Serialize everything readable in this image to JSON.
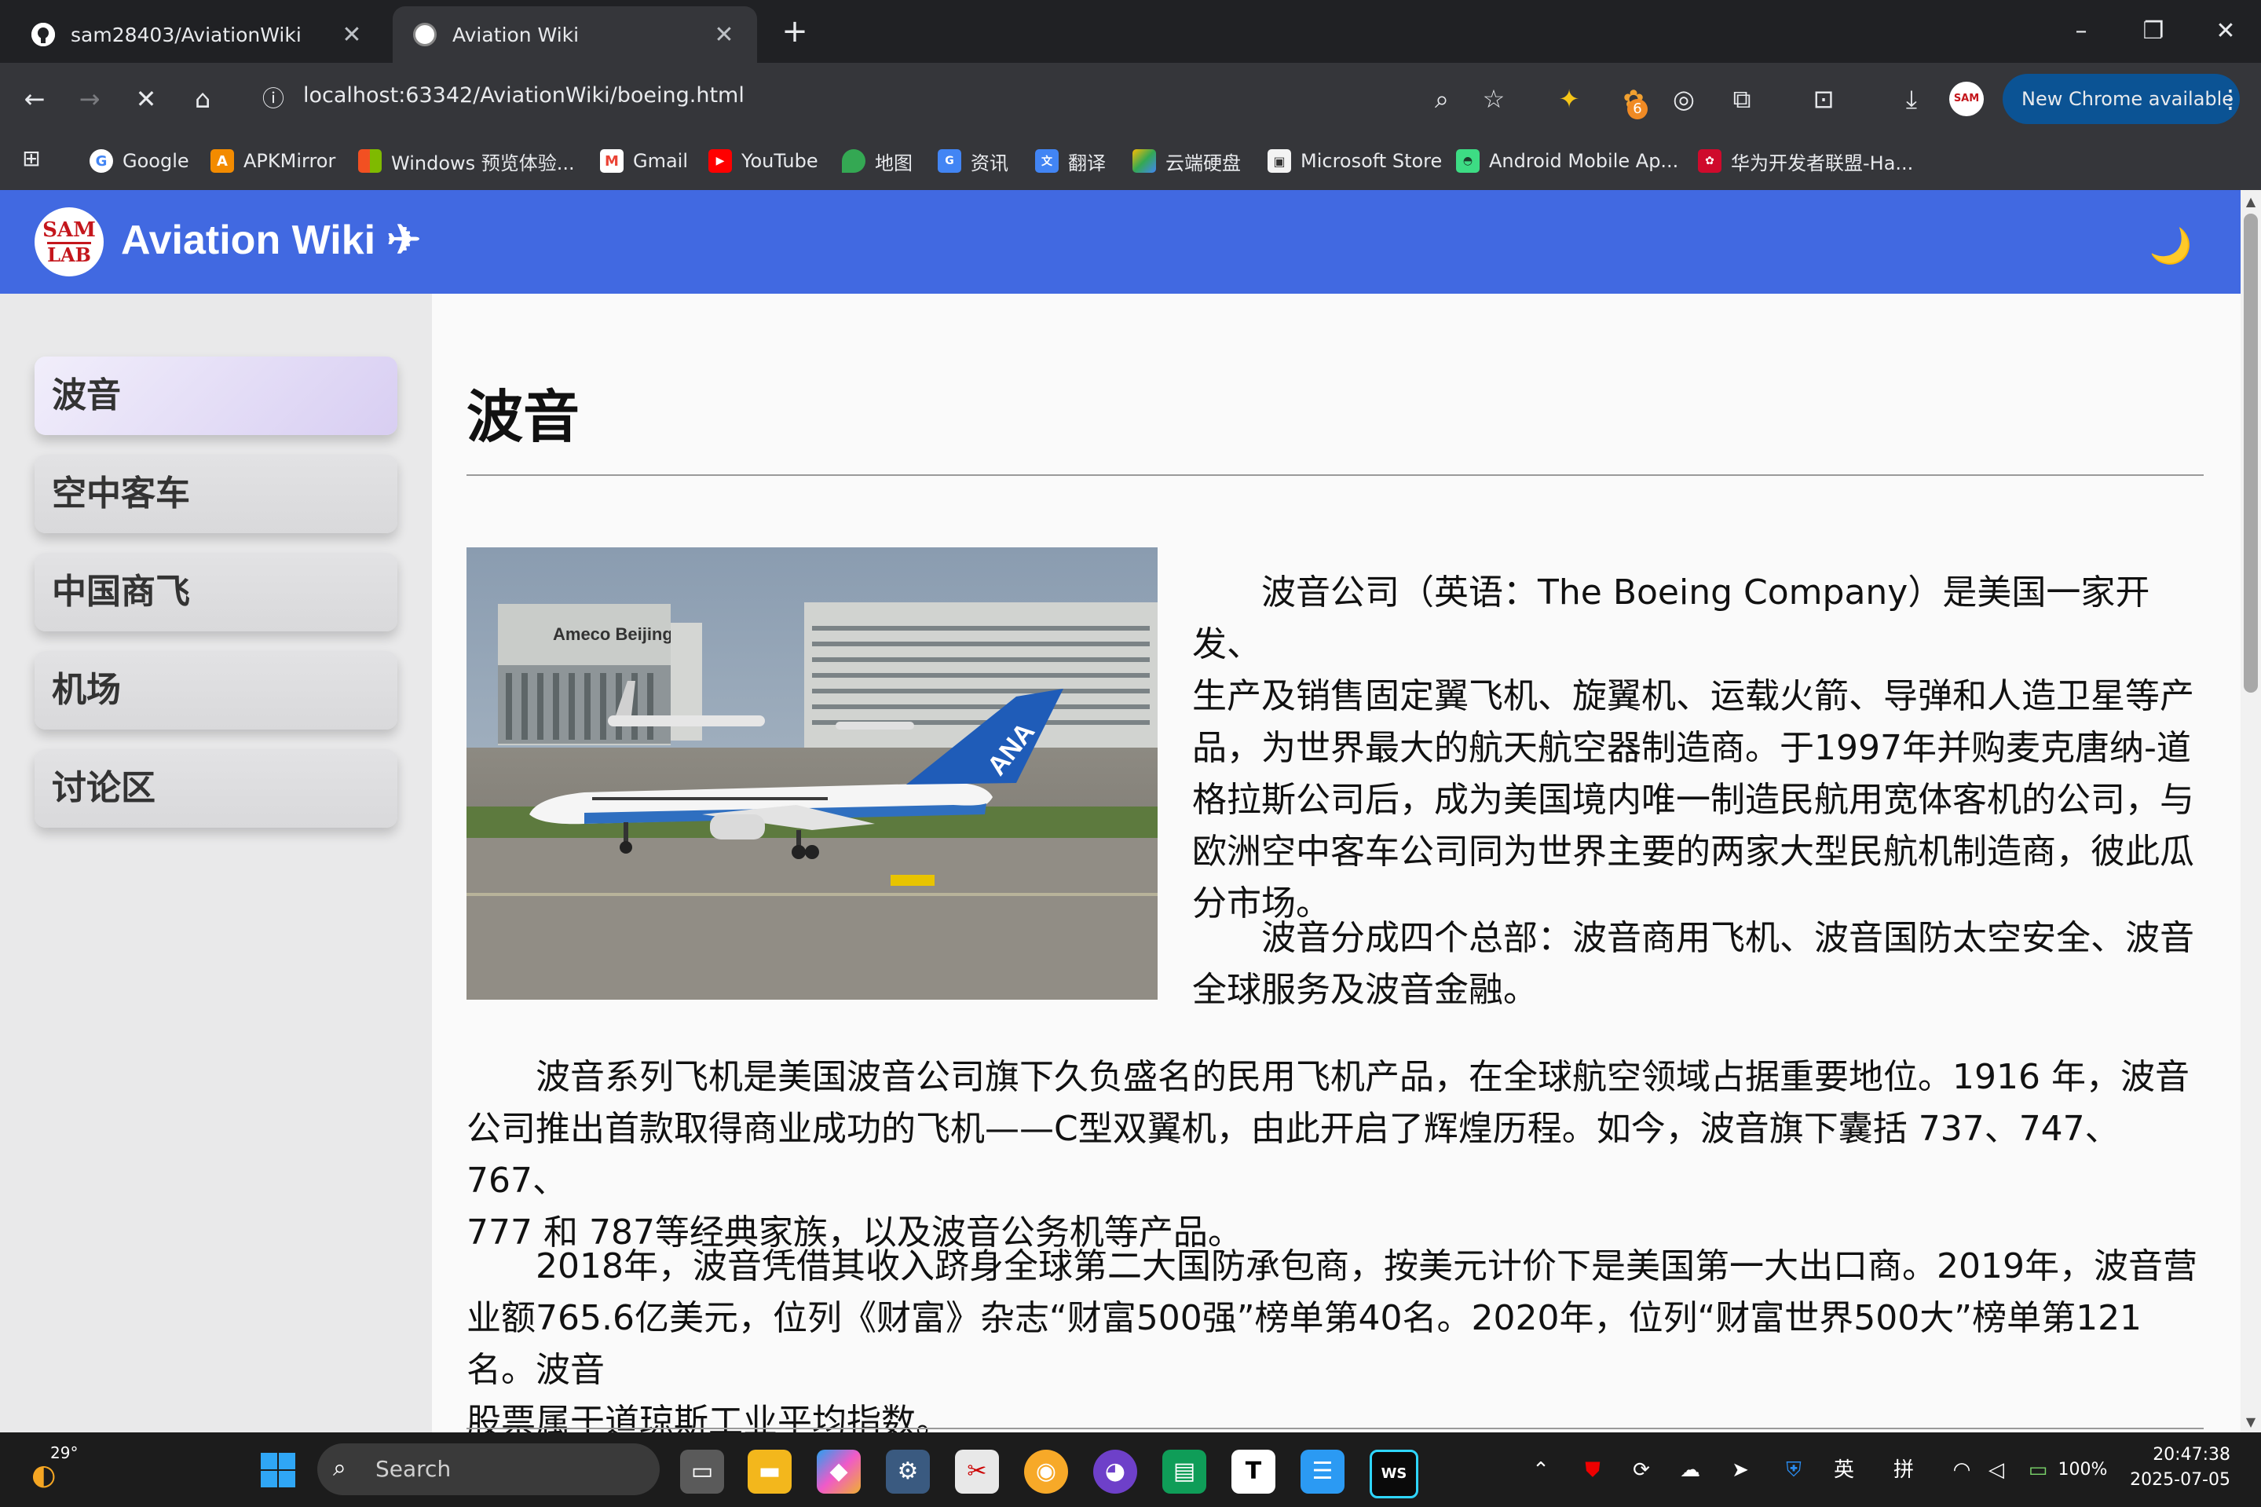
{
  "browser": {
    "tabs": [
      {
        "title": "sam28403/AviationWiki",
        "active": false
      },
      {
        "title": "Aviation Wiki",
        "active": true
      }
    ],
    "url": "localhost:63342/AviationWiki/boeing.html",
    "update_button": "New Chrome available",
    "extension_badge": "6",
    "bookmarks": [
      {
        "label": "Google",
        "icon": "google-icon"
      },
      {
        "label": "APKMirror",
        "icon": "apkmirror-icon"
      },
      {
        "label": "Windows 预览体验...",
        "icon": "windows-icon"
      },
      {
        "label": "Gmail",
        "icon": "gmail-icon"
      },
      {
        "label": "YouTube",
        "icon": "youtube-icon"
      },
      {
        "label": "地图",
        "icon": "maps-icon"
      },
      {
        "label": "资讯",
        "icon": "news-icon"
      },
      {
        "label": "翻译",
        "icon": "translate-icon"
      },
      {
        "label": "云端硬盘",
        "icon": "drive-icon"
      },
      {
        "label": "Microsoft Store",
        "icon": "store-icon"
      },
      {
        "label": "Android Mobile Ap...",
        "icon": "android-icon"
      },
      {
        "label": "华为开发者联盟-Ha...",
        "icon": "huawei-icon"
      }
    ]
  },
  "site": {
    "title": "Aviation Wiki ✈",
    "logo_line1": "SAM",
    "logo_line2": "LAB",
    "theme_toggle": "🌙",
    "accent_color": "#4169e1"
  },
  "sidebar": {
    "items": [
      {
        "label": "波音",
        "active": true
      },
      {
        "label": "空中客车",
        "active": false
      },
      {
        "label": "中国商飞",
        "active": false
      },
      {
        "label": "机场",
        "active": false
      },
      {
        "label": "讨论区",
        "active": false
      }
    ]
  },
  "content": {
    "title": "波音",
    "image_alt": "ANA Boeing 787 taxiing at Beijing airport near Ameco Beijing hangar",
    "image_hangar_text": "Ameco Beijing",
    "image_tail_text": "ANA",
    "p1_lines": [
      "波音公司（英语：The Boeing Company）是美国一家开发、",
      "生产及销售固定翼飞机、旋翼机、运载火箭、导弹和人造卫星等产",
      "品，为世界最大的航天航空器制造商。于1997年并购麦克唐纳-道",
      "格拉斯公司后，成为美国境内唯一制造民航用宽体客机的公司，与",
      "欧洲空中客车公司同为世界主要的两家大型民航机制造商，彼此瓜",
      "分市场。"
    ],
    "p2_lines": [
      "波音分成四个总部：波音商用飞机、波音国防太空安全、波音",
      "全球服务及波音金融。"
    ],
    "p3_lines": [
      "波音系列飞机是美国波音公司旗下久负盛名的民用飞机产品，在全球航空领域占据重要地位。1916 年，波音",
      "公司推出首款取得商业成功的飞机——C型双翼机，由此开启了辉煌历程。如今，波音旗下囊括 737、747、767、",
      "777 和 787等经典家族，以及波音公务机等产品。"
    ],
    "p4_lines": [
      "2018年，波音凭借其收入跻身全球第二大国防承包商，按美元计价下是美国第一大出口商。2019年，波音营",
      "业额765.6亿美元，位列《财富》杂志“财富500强”榜单第40名。2020年，位列“财富世界500大”榜单第121名。波音",
      "股票属于道琼斯工业平均指数。"
    ]
  },
  "taskbar": {
    "weather_temp": "29°",
    "search_placeholder": "Search",
    "ime_lang": "英",
    "ime_mode": "拼",
    "battery": "100%",
    "time": "20:47:38",
    "date": "2025-07-05"
  }
}
